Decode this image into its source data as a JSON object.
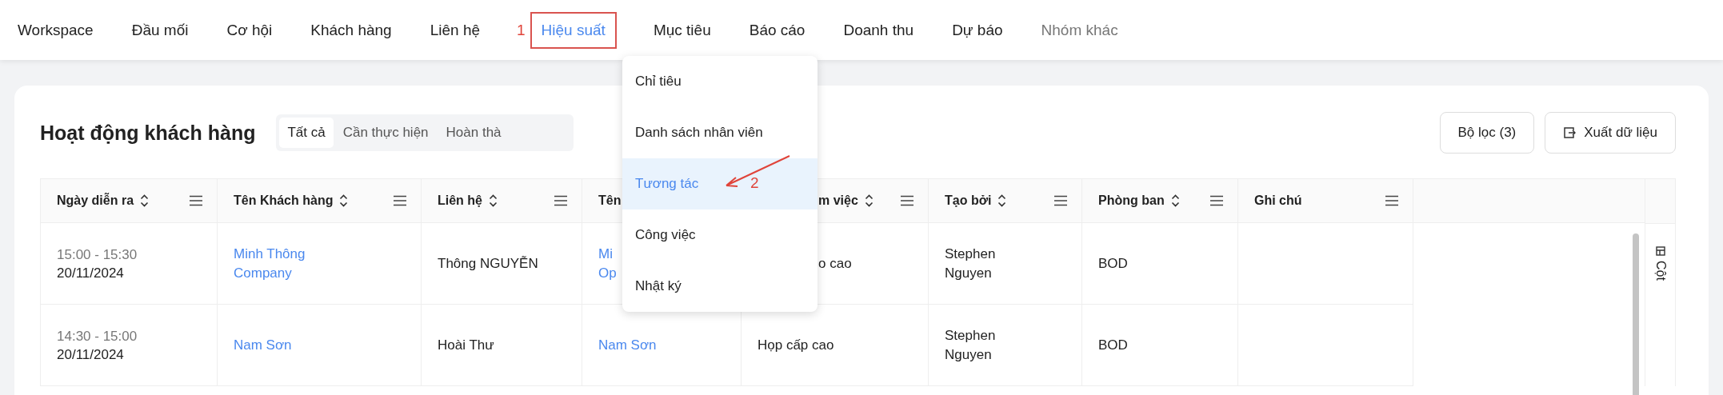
{
  "nav": {
    "items": [
      {
        "label": "Workspace",
        "selected": false,
        "muted": false
      },
      {
        "label": "Đầu mối",
        "selected": false,
        "muted": false
      },
      {
        "label": "Cơ hội",
        "selected": false,
        "muted": false
      },
      {
        "label": "Khách hàng",
        "selected": false,
        "muted": false
      },
      {
        "label": "Liên hệ",
        "selected": false,
        "muted": false
      },
      {
        "label": "Hiệu suất",
        "selected": true,
        "muted": false,
        "marker": "1"
      },
      {
        "label": "Mục tiêu",
        "selected": false,
        "muted": false
      },
      {
        "label": "Báo cáo",
        "selected": false,
        "muted": false
      },
      {
        "label": "Doanh thu",
        "selected": false,
        "muted": false
      },
      {
        "label": "Dự báo",
        "selected": false,
        "muted": false
      },
      {
        "label": "Nhóm khác",
        "selected": false,
        "muted": true
      }
    ]
  },
  "dropdown": {
    "items": [
      {
        "label": "Chỉ tiêu",
        "selected": false
      },
      {
        "label": "Danh sách nhân viên",
        "selected": false
      },
      {
        "label": "Tương tác",
        "selected": true,
        "marker": "2"
      },
      {
        "label": "Công việc",
        "selected": false
      },
      {
        "label": "Nhật ký",
        "selected": false
      }
    ]
  },
  "card": {
    "title": "Hoạt động khách hàng",
    "tabs": [
      {
        "label": "Tất cả",
        "selected": true
      },
      {
        "label": "Cần thực hiện",
        "selected": false
      },
      {
        "label": "Hoàn thà",
        "selected": false
      }
    ],
    "buttons": [
      {
        "label": "Bộ lọc (3)",
        "kind": "plain"
      },
      {
        "label": "Xuất dữ liệu",
        "kind": "export"
      }
    ]
  },
  "table": {
    "columns": [
      {
        "label": "Ngày diễn ra",
        "sortable": true,
        "menu": true,
        "clipped": false
      },
      {
        "label": "Tên Khách hàng",
        "sortable": true,
        "menu": true,
        "clipped": false
      },
      {
        "label": "Liên hệ",
        "sortable": true,
        "menu": true,
        "clipped": false
      },
      {
        "label": "Tên",
        "clipped": false
      },
      {
        "label": "m việc",
        "sortable": true,
        "menu": true,
        "clipped": true
      },
      {
        "label": "Tạo bởi",
        "sortable": true,
        "menu": true,
        "clipped": false
      },
      {
        "label": "Phòng ban",
        "sortable": true,
        "menu": true,
        "clipped": false
      },
      {
        "label": "Ghi chú",
        "sortable": false,
        "menu": true,
        "clipped": false
      }
    ],
    "rows": [
      {
        "cells": [
          {
            "kind": "datetime",
            "time": "15:00 - 15:30",
            "date": "20/11/2024"
          },
          {
            "kind": "link",
            "text": "Minh Thông\nCompany"
          },
          {
            "kind": "text",
            "text": "Thông NGUYỄN"
          },
          {
            "kind": "link",
            "text": "Mi\nOp"
          },
          {
            "kind": "text",
            "text": "o cao",
            "clipped": true
          },
          {
            "kind": "text",
            "text": "Stephen\nNguyen"
          },
          {
            "kind": "text",
            "text": "BOD"
          },
          {
            "kind": "empty"
          }
        ]
      },
      {
        "cells": [
          {
            "kind": "datetime",
            "time": "14:30 - 15:00",
            "date": "20/11/2024"
          },
          {
            "kind": "link",
            "text": "Nam Sơn"
          },
          {
            "kind": "text",
            "text": "Hoài Thư"
          },
          {
            "kind": "link",
            "text": "Nam Sơn"
          },
          {
            "kind": "text",
            "text": "Họp cấp cao"
          },
          {
            "kind": "text",
            "text": "Stephen\nNguyen"
          },
          {
            "kind": "text",
            "text": "BOD"
          },
          {
            "kind": "empty"
          }
        ]
      }
    ]
  },
  "column_panel": {
    "label": "Cột"
  }
}
